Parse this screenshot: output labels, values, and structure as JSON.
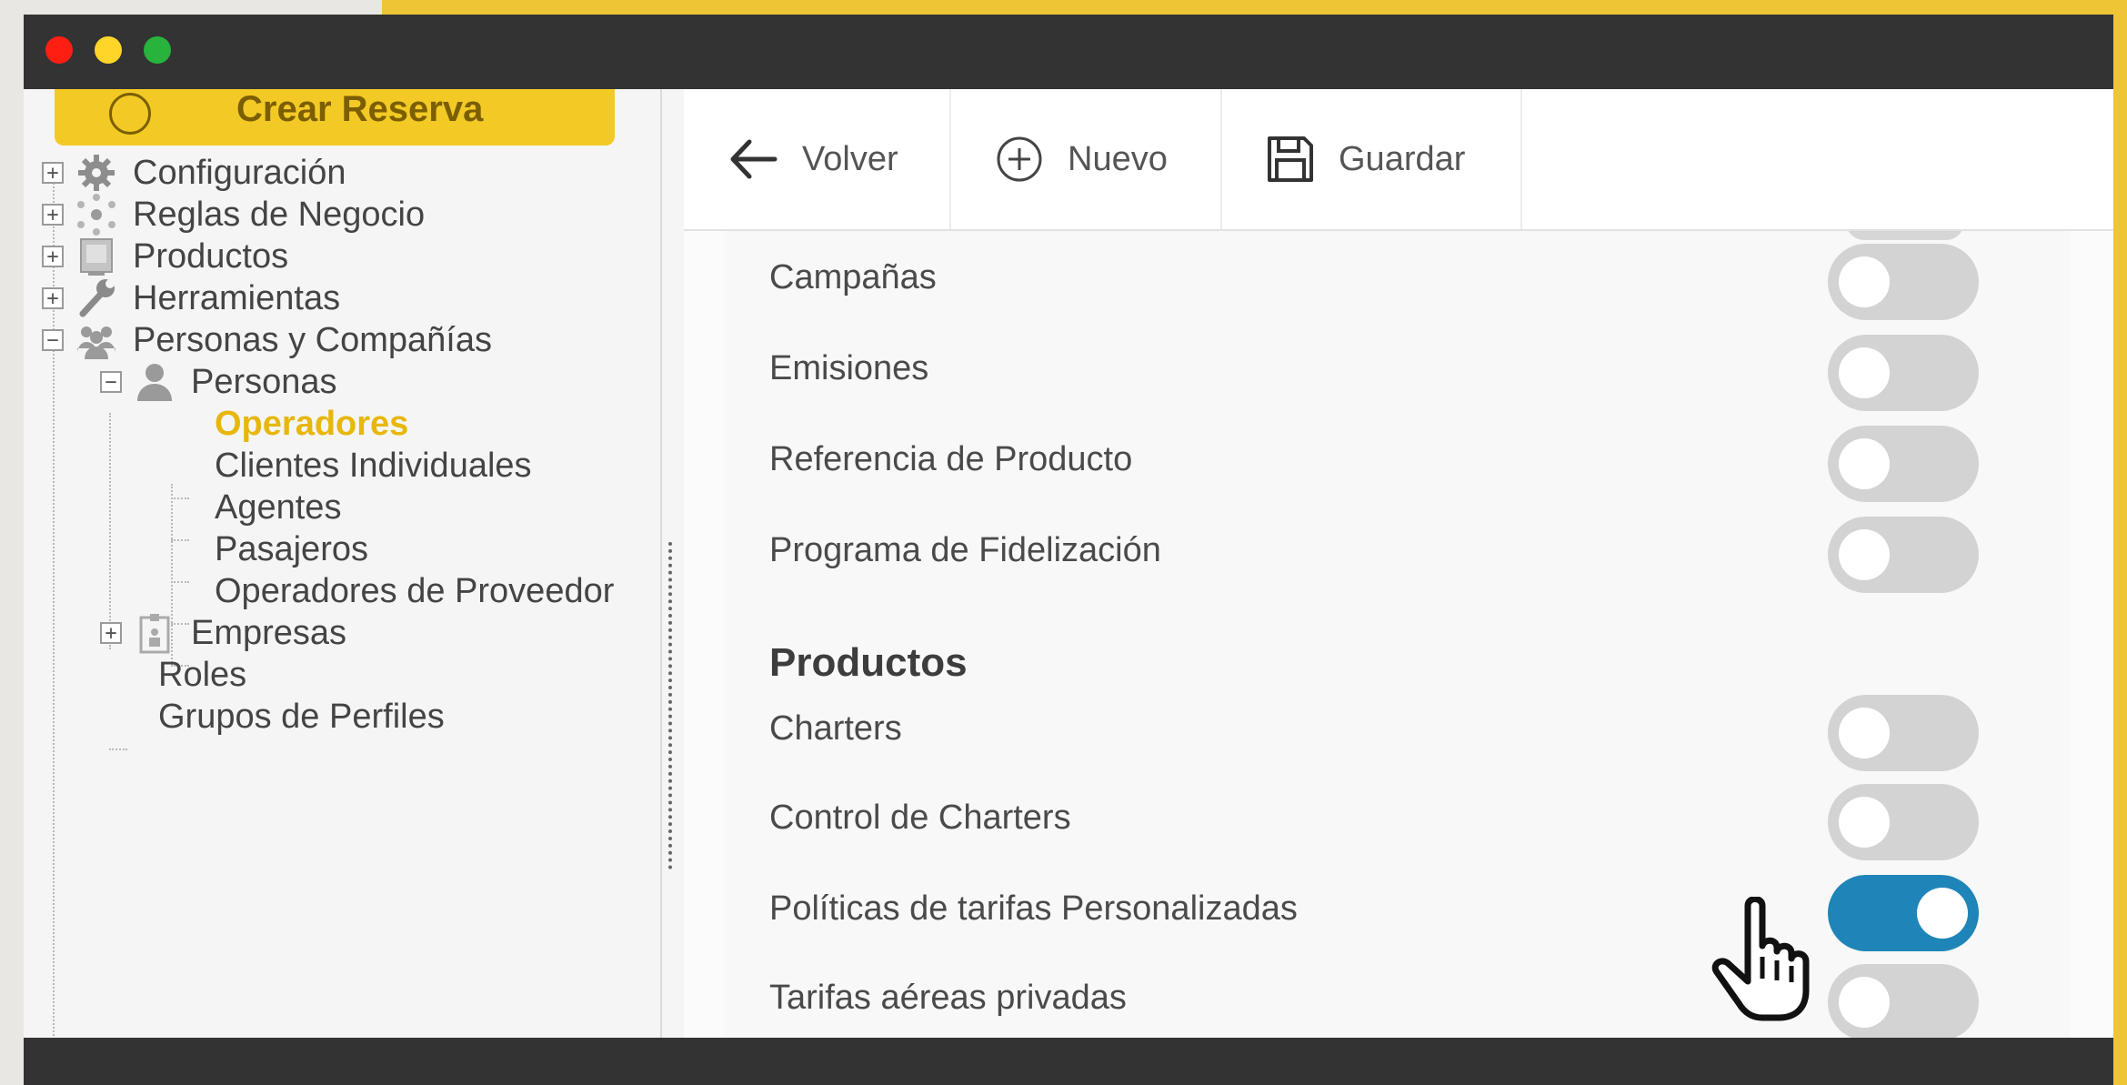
{
  "window": {
    "controls": [
      "close",
      "minimize",
      "maximize"
    ],
    "colors": {
      "titlebar": "#333333",
      "accent": "#f3ca25",
      "toggle_on": "#1f85b8",
      "toggle_off": "#d3d3d3"
    }
  },
  "sidebar": {
    "cta_label": "Crear Reserva",
    "items": [
      {
        "label": "Configuración",
        "icon": "gear-icon",
        "expanded": false
      },
      {
        "label": "Reglas de Negocio",
        "icon": "network-icon",
        "expanded": false
      },
      {
        "label": "Productos",
        "icon": "product-icon",
        "expanded": false
      },
      {
        "label": "Herramientas",
        "icon": "wrench-icon",
        "expanded": false
      },
      {
        "label": "Personas y Compañías",
        "icon": "people-icon",
        "expanded": true
      },
      {
        "label": "Personas",
        "icon": "person-icon",
        "expanded": true
      },
      {
        "label": "Operadores",
        "active": true
      },
      {
        "label": "Clientes Individuales"
      },
      {
        "label": "Agentes"
      },
      {
        "label": "Pasajeros"
      },
      {
        "label": "Operadores de Proveedor"
      },
      {
        "label": "Empresas",
        "icon": "company-icon",
        "expanded": false
      },
      {
        "label": "Roles"
      },
      {
        "label": "Grupos de Perfiles"
      }
    ]
  },
  "toolbar": {
    "back_label": "Volver",
    "new_label": "Nuevo",
    "save_label": "Guardar"
  },
  "settings": {
    "items_top": [
      {
        "label": "Campañas",
        "enabled": false
      },
      {
        "label": "Emisiones",
        "enabled": false
      },
      {
        "label": "Referencia de Producto",
        "enabled": false
      },
      {
        "label": "Programa de Fidelización",
        "enabled": false
      }
    ],
    "section_title": "Productos",
    "items_products": [
      {
        "label": "Charters",
        "enabled": false
      },
      {
        "label": "Control de Charters",
        "enabled": false
      },
      {
        "label": "Políticas de tarifas Personalizadas",
        "enabled": true
      },
      {
        "label": "Tarifas aéreas privadas",
        "enabled": false
      }
    ]
  }
}
